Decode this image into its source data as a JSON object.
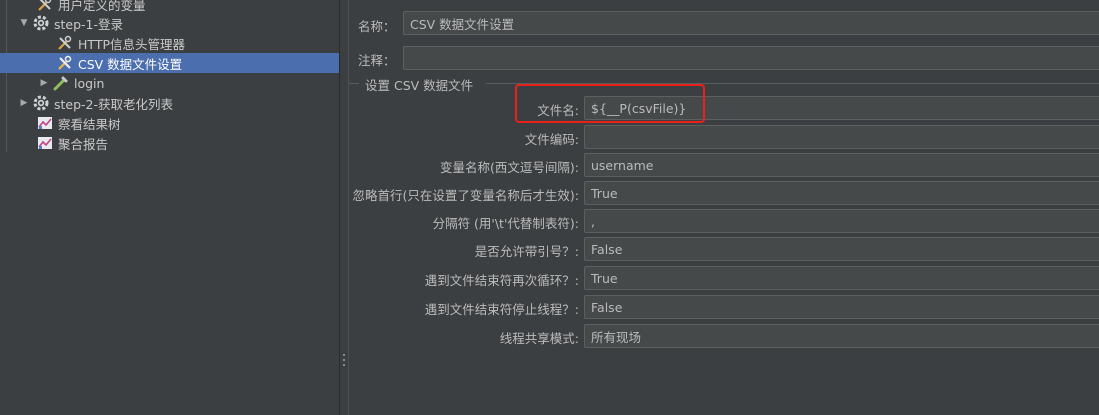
{
  "tree": {
    "items": [
      {
        "label": "用户定义的变量",
        "icon": "wrench-icon"
      },
      {
        "label": "step-1-登录",
        "icon": "gear-icon"
      },
      {
        "label": "HTTP信息头管理器",
        "icon": "wrench-icon"
      },
      {
        "label": "CSV 数据文件设置",
        "icon": "wrench-icon",
        "selected": true
      },
      {
        "label": "login",
        "icon": "pipette-icon"
      },
      {
        "label": "step-2-获取老化列表",
        "icon": "gear-icon"
      },
      {
        "label": "察看结果树",
        "icon": "chart-icon"
      },
      {
        "label": "聚合报告",
        "icon": "chart-icon"
      }
    ]
  },
  "form": {
    "name_label": "名称：",
    "name_value": "CSV 数据文件设置",
    "comment_label": "注释：",
    "comment_value": "",
    "group_title": "设置 CSV 数据文件",
    "rows": [
      {
        "label": "文件名:",
        "value": "${__P(csvFile)}"
      },
      {
        "label": "文件编码:",
        "value": ""
      },
      {
        "label": "变量名称(西文逗号间隔):",
        "value": "username"
      },
      {
        "label": "忽略首行(只在设置了变量名称后才生效):",
        "value": "True"
      },
      {
        "label": "分隔符 (用'\\t'代替制表符):",
        "value": ","
      },
      {
        "label": "是否允许带引号？:",
        "value": "False"
      },
      {
        "label": "遇到文件结束符再次循环？:",
        "value": "True"
      },
      {
        "label": "遇到文件结束符停止线程？:",
        "value": "False"
      },
      {
        "label": "线程共享模式:",
        "value": "所有现场"
      }
    ]
  },
  "colors": {
    "selection": "#4b6eaf",
    "highlight": "#e8221b",
    "panel_bg": "#3c3f41"
  }
}
